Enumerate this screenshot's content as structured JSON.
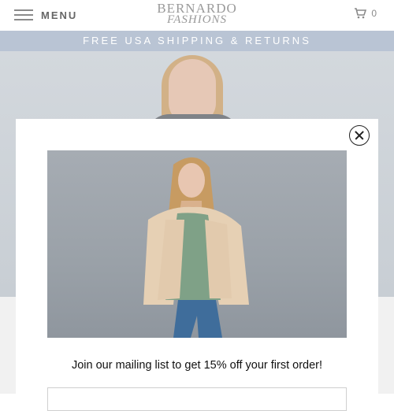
{
  "header": {
    "menu_label": "MENU",
    "logo_line1": "BERNARDO",
    "logo_line2": "FASHIONS",
    "cart_count": "0"
  },
  "banner": {
    "text": "FREE USA SHIPPING & RETURNS"
  },
  "popup": {
    "promo_text": "Join our mailing list to get 15% off your first order!",
    "email_placeholder": ""
  },
  "colors": {
    "banner_bg": "#b9c4d4",
    "hero_bg": "#cfd4d9",
    "popup_bg": "#ffffff"
  },
  "icons": [
    "hamburger-icon",
    "cart-icon",
    "close-icon"
  ]
}
